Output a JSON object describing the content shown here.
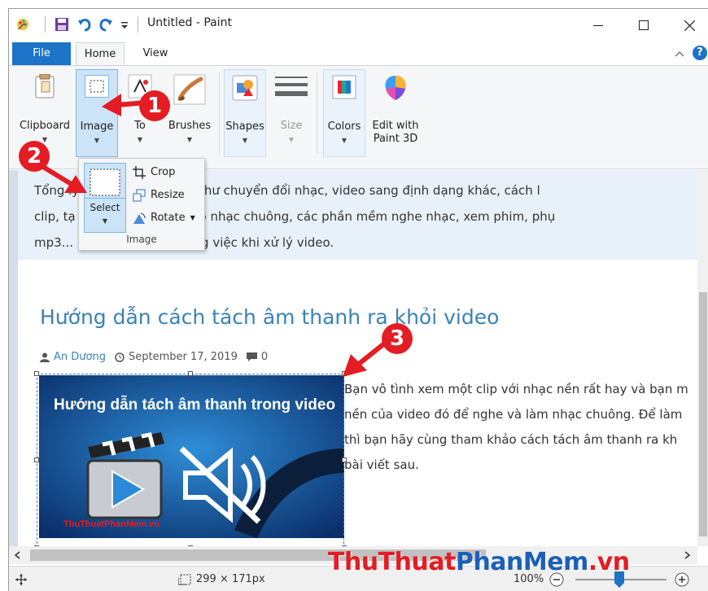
{
  "window": {
    "title": "Untitled - Paint",
    "controls": {
      "minimize": "—",
      "maximize": "☐",
      "close": "✕"
    }
  },
  "tabs": {
    "file": "File",
    "home": "Home",
    "view": "View"
  },
  "ribbon": {
    "clipboard": "Clipboard",
    "image": "Image",
    "tools": "To",
    "brushes": "Brushes",
    "shapes": "Shapes",
    "size": "Size",
    "colors": "Colors",
    "edit3d_line1": "Edit with",
    "edit3d_line2": "Paint 3D"
  },
  "image_dropdown": {
    "select": "Select",
    "crop": "Crop",
    "resize": "Resize",
    "rotate": "Rotate",
    "group_label": "Image"
  },
  "canvas": {
    "intro_lines": [
      "Tổng                   lý phim audio, video như chuyển đổi nhạc, video sang định dạng khác, cách l",
      "clip, tạ                 ra video, ghi âm, tạo nhạc chuông, các phần mềm nghe nhạc, xem phim, phụ",
      "mp3...                   ng cao hiệu quả công việc khi xử lý video."
    ],
    "article_title": "Hướng dẫn cách tách âm thanh ra khỏi video",
    "author": "An Dương",
    "date": "September 17, 2019",
    "comments": "0",
    "body_lines": [
      "Bạn vô tình xem một clip với nhạc nền rất hay và bạn m",
      "nền của video đó để nghe và làm nhạc chuông. Để làm",
      "thì bạn hãy cùng tham khảo cách tách âm thanh ra kh",
      "bài viết sau."
    ],
    "thumbnail_title": "Hướng dẫn tách âm thanh trong video",
    "thumbnail_watermark": "ThuThuatPhanMem.vn"
  },
  "status": {
    "selection_size": "299 × 171px",
    "zoom": "100%"
  },
  "watermark": {
    "part1": "ThuThuat",
    "part2": "PhanMem",
    "part3": ".vn"
  },
  "annotations": {
    "step1": "1",
    "step2": "2",
    "step3": "3"
  },
  "colors": {
    "accent": "#1c73c7",
    "annotation": "#e41c23",
    "link": "#3b82b8"
  }
}
